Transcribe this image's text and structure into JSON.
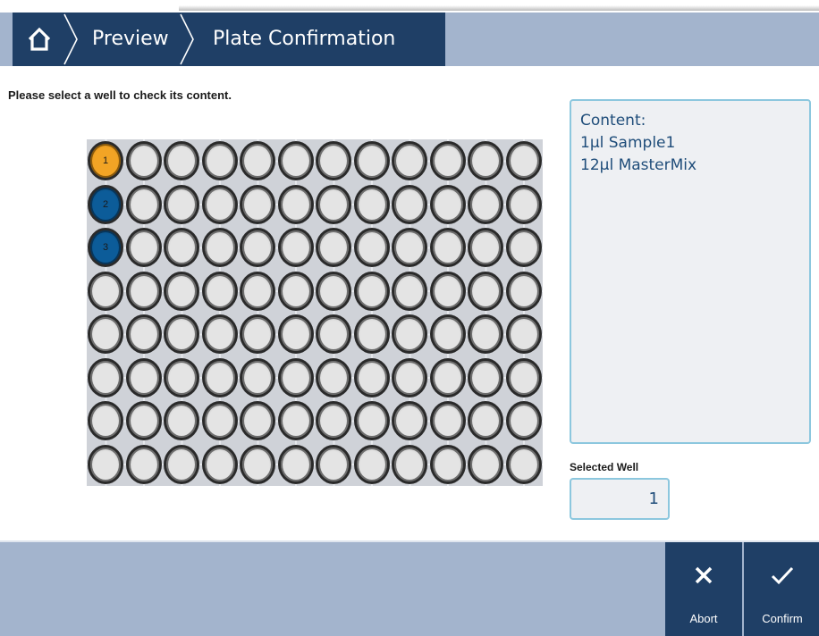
{
  "header": {
    "breadcrumbs": [
      {
        "label": "Preview"
      },
      {
        "label": "Plate Confirmation"
      }
    ]
  },
  "instruction": "Please select a well to check its content.",
  "plate": {
    "rows": 8,
    "columns": 12,
    "wells": [
      {
        "row": 0,
        "col": 0,
        "label": "1",
        "color": "#f2a425"
      },
      {
        "row": 1,
        "col": 0,
        "label": "2",
        "color": "#0c5c99"
      },
      {
        "row": 2,
        "col": 0,
        "label": "3",
        "color": "#0c5c99"
      }
    ]
  },
  "content": {
    "title": "Content:",
    "lines": [
      "1µl Sample1",
      "12µl MasterMix"
    ]
  },
  "selected_well": {
    "label": "Selected Well",
    "value": "1"
  },
  "footer": {
    "abort_label": "Abort",
    "confirm_label": "Confirm"
  },
  "colors": {
    "nav_dark": "#1f3f66",
    "nav_light": "#a3b4cd",
    "accent_border": "#8cc7de",
    "text_blue": "#1f4d7a"
  }
}
